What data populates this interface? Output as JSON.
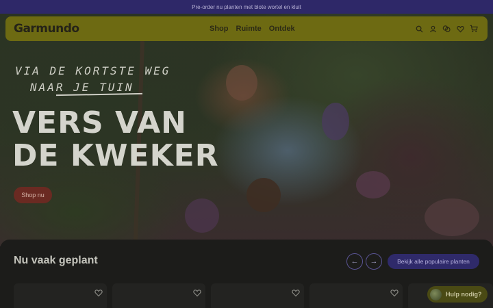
{
  "announcement": "Pre-order nu planten met blote wortel en kluit",
  "header": {
    "logo": "Garmundo",
    "nav": [
      "Shop",
      "Ruimte",
      "Ontdek"
    ],
    "icons": [
      "search-icon",
      "account-icon",
      "compare-icon",
      "wishlist-icon",
      "cart-icon"
    ]
  },
  "hero": {
    "script_line1": "VIA DE KORTSTE WEG",
    "script_line2": "NAAR JE TUIN",
    "headline_line1": "VERS VAN",
    "headline_line2": "DE KWEKER",
    "cta": "Shop nu"
  },
  "products": {
    "title": "Nu vaak geplant",
    "prev_icon": "arrow-left-icon",
    "next_icon": "arrow-right-icon",
    "view_all": "Bekijk alle populaire planten"
  },
  "help": {
    "label": "Hulp nodig?"
  },
  "colors": {
    "accent": "#2f2a6a",
    "header": "#6d6a12",
    "cta": "#6a2a22"
  }
}
